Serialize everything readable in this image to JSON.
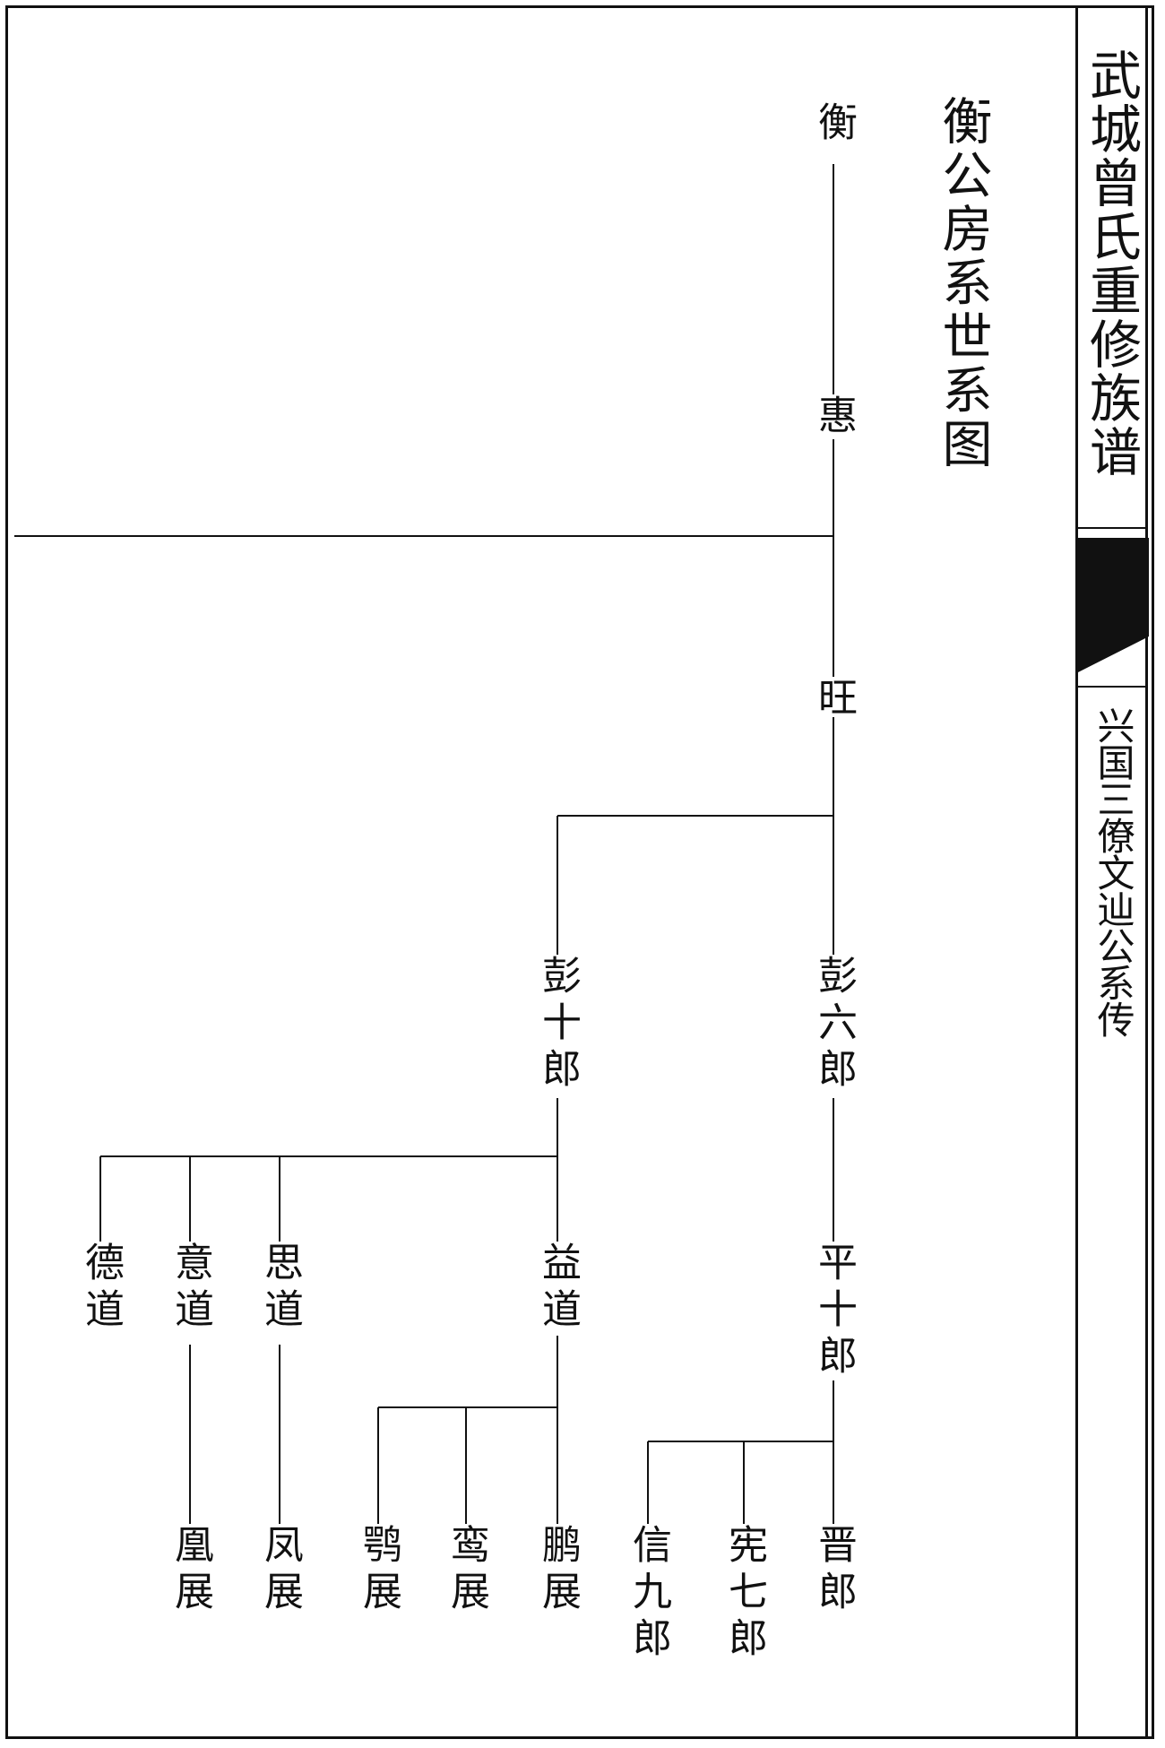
{
  "book_title": "武城曾氏重修族谱",
  "chapter_title": "兴国三僚文辿公系传",
  "section_title": "衡公房系世系图",
  "tree": {
    "people": [
      {
        "id": "heng",
        "name": "衡"
      },
      {
        "id": "hui",
        "name": "惠"
      },
      {
        "id": "wang",
        "name": "旺"
      },
      {
        "id": "peng6",
        "name": "彭六郎"
      },
      {
        "id": "peng10",
        "name": "彭十郎"
      },
      {
        "id": "ping10",
        "name": "平十郎"
      },
      {
        "id": "yidao",
        "name": "益道"
      },
      {
        "id": "sidao",
        "name": "思道"
      },
      {
        "id": "yidao2",
        "name": "意道"
      },
      {
        "id": "dedao",
        "name": "德道"
      },
      {
        "id": "jinlang",
        "name": "晋郎"
      },
      {
        "id": "xian7",
        "name": "宪七郎"
      },
      {
        "id": "xin9",
        "name": "信九郎"
      },
      {
        "id": "pengzhan",
        "name": "鹏展"
      },
      {
        "id": "luanzhan",
        "name": "鸾展"
      },
      {
        "id": "ezhan",
        "name": "鹗展"
      },
      {
        "id": "fengzhan",
        "name": "凤展"
      },
      {
        "id": "huangzhan",
        "name": "凰展"
      }
    ],
    "links": [
      [
        "heng",
        "hui"
      ],
      [
        "hui",
        "wang"
      ],
      [
        "wang",
        "peng6"
      ],
      [
        "wang",
        "peng10"
      ],
      [
        "peng6",
        "ping10"
      ],
      [
        "peng10",
        "yidao"
      ],
      [
        "peng10",
        "sidao"
      ],
      [
        "peng10",
        "yidao2"
      ],
      [
        "peng10",
        "dedao"
      ],
      [
        "ping10",
        "jinlang"
      ],
      [
        "ping10",
        "xian7"
      ],
      [
        "ping10",
        "xin9"
      ],
      [
        "yidao",
        "pengzhan"
      ],
      [
        "yidao",
        "luanzhan"
      ],
      [
        "yidao",
        "ezhan"
      ],
      [
        "sidao",
        "fengzhan"
      ],
      [
        "yidao2",
        "huangzhan"
      ]
    ]
  },
  "colors": {
    "ink": "#111111",
    "paper": "#ffffff"
  }
}
